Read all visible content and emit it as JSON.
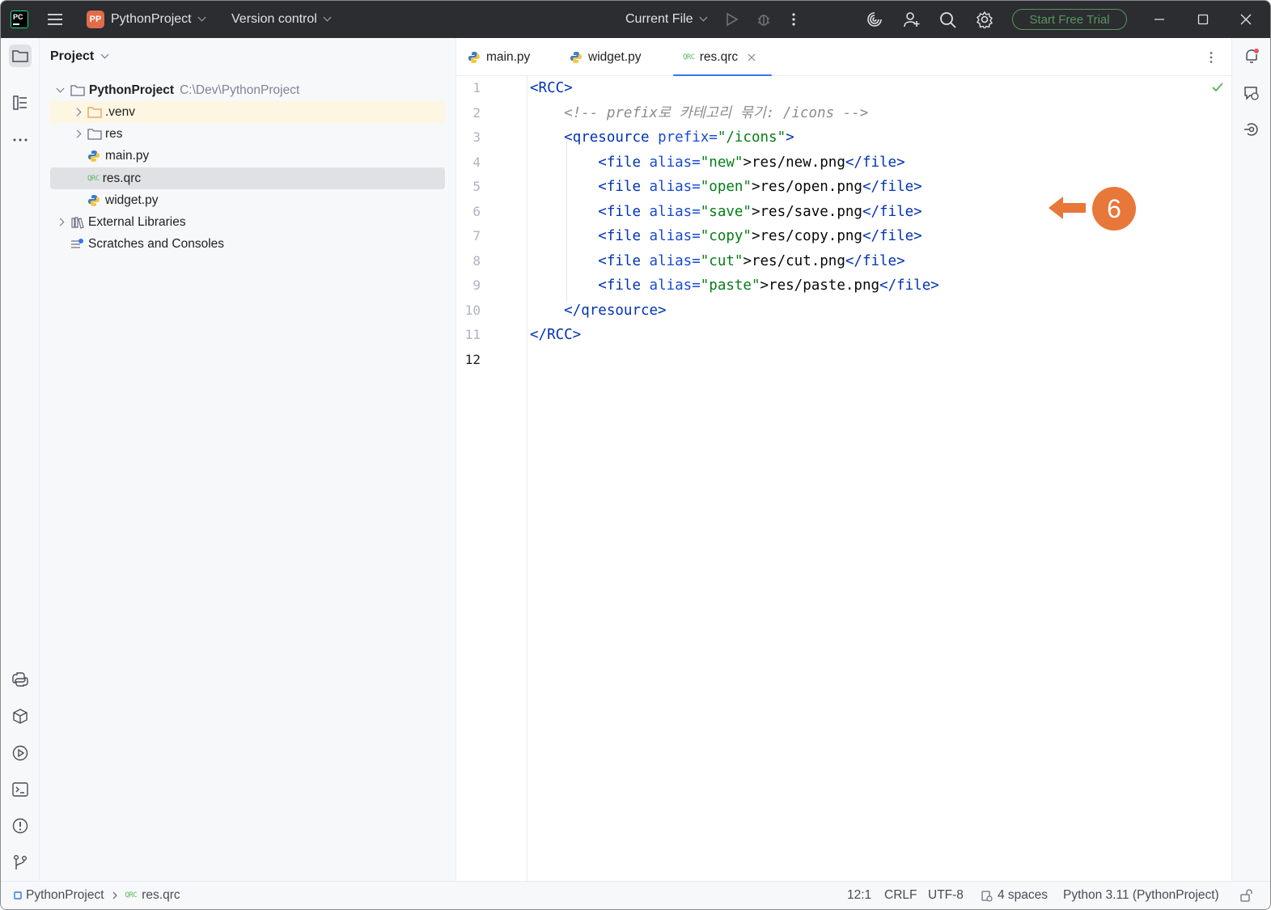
{
  "titlebar": {
    "project_badge": "PP",
    "project_name": "PythonProject",
    "version_control": "Version control",
    "run_config": "Current File",
    "trial_button": "Start Free Trial"
  },
  "project_panel": {
    "title": "Project",
    "root_name": "PythonProject",
    "root_path": "C:\\Dev\\PythonProject",
    "items": [
      {
        "label": ".venv"
      },
      {
        "label": "res"
      },
      {
        "label": "main.py"
      },
      {
        "label": "res.qrc"
      },
      {
        "label": "widget.py"
      },
      {
        "label": "External Libraries"
      },
      {
        "label": "Scratches and Consoles"
      }
    ]
  },
  "editor": {
    "tabs": [
      {
        "label": "main.py"
      },
      {
        "label": "widget.py"
      },
      {
        "label": "res.qrc"
      }
    ],
    "qrc_icon_text": "QRC",
    "line_numbers": [
      "1",
      "2",
      "3",
      "4",
      "5",
      "6",
      "7",
      "8",
      "9",
      "10",
      "11",
      "12"
    ],
    "code": {
      "l1_open": "<RCC>",
      "l2_comment": "<!-- prefix로 카테고리 묶기: /icons -->",
      "l3_tag": "<qresource",
      "l3_attr": "prefix=",
      "l3_val": "\"/icons\"",
      "l3_close": ">",
      "file_open": "<file",
      "alias_attr": "alias=",
      "file_close_tag": "</file>",
      "files": [
        {
          "alias": "\"new\"",
          "path": ">res/new.png"
        },
        {
          "alias": "\"open\"",
          "path": ">res/open.png"
        },
        {
          "alias": "\"save\"",
          "path": ">res/save.png"
        },
        {
          "alias": "\"copy\"",
          "path": ">res/copy.png"
        },
        {
          "alias": "\"cut\"",
          "path": ">res/cut.png"
        },
        {
          "alias": "\"paste\"",
          "path": ">res/paste.png"
        }
      ],
      "l10": "</qresource>",
      "l11": "</RCC>"
    },
    "callout_number": "6"
  },
  "status_bar": {
    "breadcrumb_project": "PythonProject",
    "breadcrumb_file": "res.qrc",
    "position": "12:1",
    "line_sep": "CRLF",
    "encoding": "UTF-8",
    "indent": "4 spaces",
    "interpreter": "Python 3.11 (PythonProject)"
  },
  "colors": {
    "accent": "#3574f0",
    "callout": "#e8773a",
    "trial_green": "#57965c"
  }
}
